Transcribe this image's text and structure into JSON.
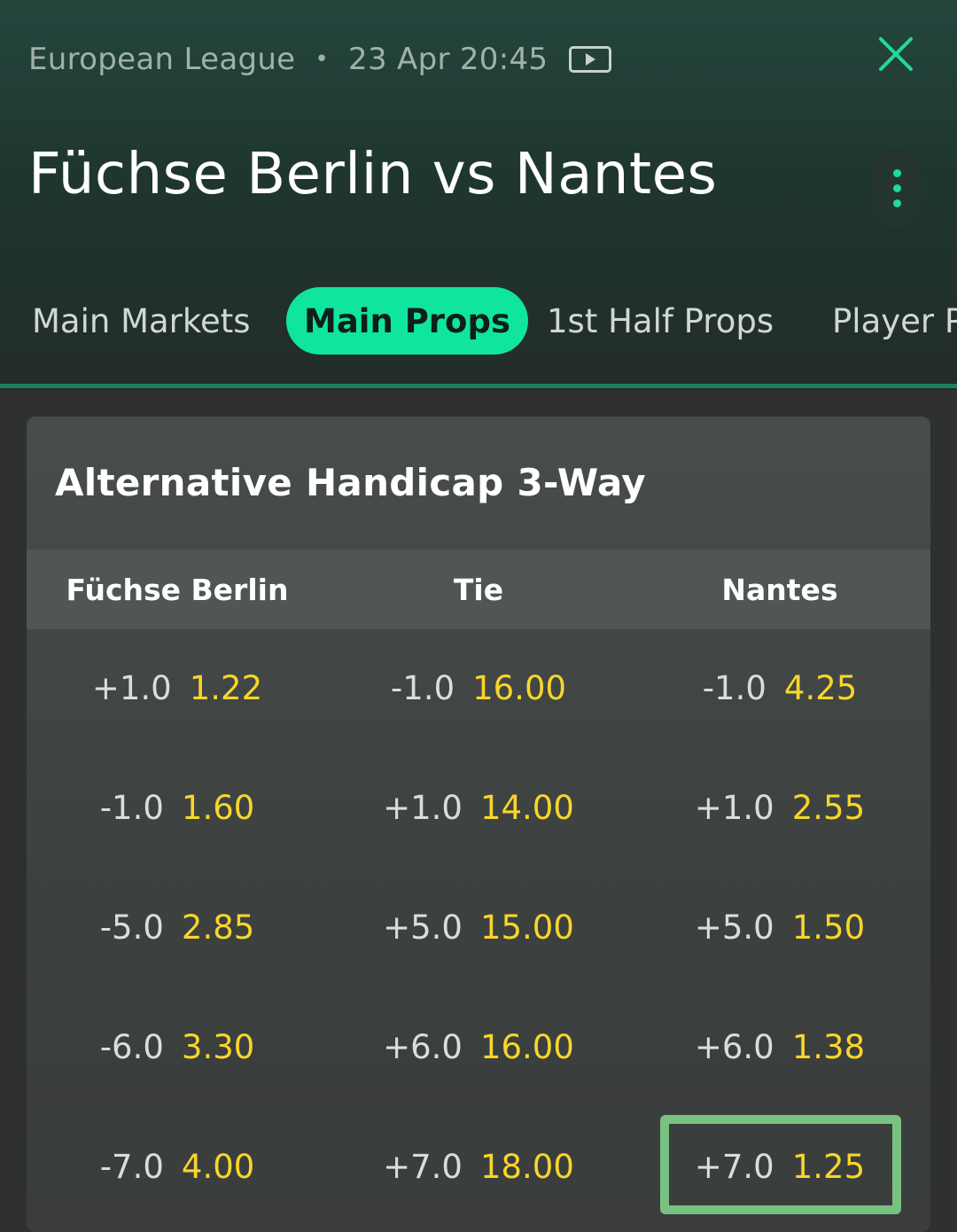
{
  "header": {
    "league": "European League",
    "separator": "•",
    "datetime": "23 Apr 20:45",
    "match_title": "Füchse Berlin vs Nantes"
  },
  "tabs": [
    {
      "label": "Main Markets",
      "active": false
    },
    {
      "label": "Main Props",
      "active": true
    },
    {
      "label": "1st Half Props",
      "active": false
    },
    {
      "label": "Player P",
      "active": false
    }
  ],
  "market": {
    "title": "Alternative Handicap 3-Way",
    "columns": [
      "Füchse Berlin",
      "Tie",
      "Nantes"
    ],
    "rows": [
      [
        {
          "hcp": "+1.0",
          "odds": "1.22"
        },
        {
          "hcp": "-1.0",
          "odds": "16.00"
        },
        {
          "hcp": "-1.0",
          "odds": "4.25"
        }
      ],
      [
        {
          "hcp": "-1.0",
          "odds": "1.60"
        },
        {
          "hcp": "+1.0",
          "odds": "14.00"
        },
        {
          "hcp": "+1.0",
          "odds": "2.55"
        }
      ],
      [
        {
          "hcp": "-5.0",
          "odds": "2.85"
        },
        {
          "hcp": "+5.0",
          "odds": "15.00"
        },
        {
          "hcp": "+5.0",
          "odds": "1.50"
        }
      ],
      [
        {
          "hcp": "-6.0",
          "odds": "3.30"
        },
        {
          "hcp": "+6.0",
          "odds": "16.00"
        },
        {
          "hcp": "+6.0",
          "odds": "1.38"
        }
      ],
      [
        {
          "hcp": "-7.0",
          "odds": "4.00"
        },
        {
          "hcp": "+7.0",
          "odds": "18.00"
        },
        {
          "hcp": "+7.0",
          "odds": "1.25"
        }
      ]
    ]
  },
  "colors": {
    "accent": "#10e5a0",
    "odds": "#f8d52a",
    "highlight_border": "#79c180"
  },
  "icons": [
    "video-icon",
    "close-icon",
    "more-options-icon"
  ]
}
